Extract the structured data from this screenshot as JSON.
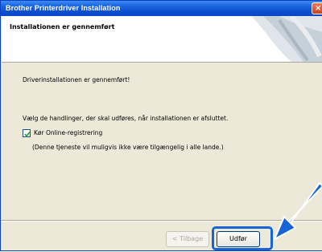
{
  "window": {
    "title": "Brother Printerdriver Installation",
    "close_symbol": "×"
  },
  "header": {
    "title": "Installationen er gennemført"
  },
  "content": {
    "line1": "Driverinstallationen er gennemført!",
    "line2": "Vælg de handlinger, der skal udføres, når installationen er afsluttet.",
    "checkbox_label": "Kør Online-registrering",
    "checkbox_checked": true,
    "note": "(Denne tjeneste vil muligvis ikke være tilgængelig i alle lande.)"
  },
  "buttons": {
    "back_label": "< Tilbage",
    "finish_label": "Udfør"
  },
  "colors": {
    "title_bar": "#0b4fd2",
    "highlight": "#1565d8"
  }
}
